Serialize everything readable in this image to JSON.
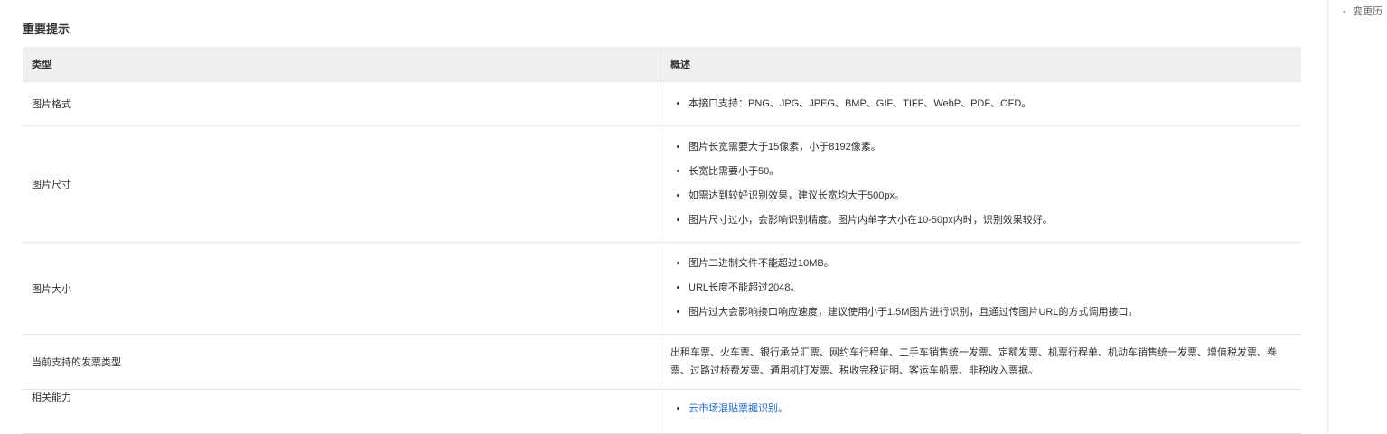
{
  "section": {
    "title": "重要提示"
  },
  "table": {
    "headers": [
      "类型",
      "概述"
    ],
    "rows": [
      {
        "type": "图片格式",
        "bullets": [
          "本接口支持：PNG、JPG、JPEG、BMP、GIF、TIFF、WebP、PDF、OFD。"
        ]
      },
      {
        "type": "图片尺寸",
        "bullets": [
          "图片长宽需要大于15像素，小于8192像素。",
          "长宽比需要小于50。",
          "如需达到较好识别效果，建议长宽均大于500px。",
          "图片尺寸过小，会影响识别精度。图片内单字大小在10-50px内时，识别效果较好。"
        ]
      },
      {
        "type": "图片大小",
        "bullets": [
          "图片二进制文件不能超过10MB。",
          "URL长度不能超过2048。",
          "图片过大会影响接口响应速度，建议使用小于1.5M图片进行识别，且通过传图片URL的方式调用接口。"
        ]
      },
      {
        "type": "当前支持的发票类型",
        "text": "出租车票、火车票、银行承兑汇票、网约车行程单、二手车销售统一发票、定额发票、机票行程单、机动车销售统一发票、增值税发票、卷票、过路过桥费发票、通用机打发票、税收完税证明、客运车船票、非税收入票据。"
      },
      {
        "type": "相关能力",
        "link": "云市场混贴票据识别。"
      }
    ]
  },
  "sidebar": {
    "item": "变更历"
  },
  "colors": {
    "link": "#1a6bd6",
    "header_bg": "#f0f0f0"
  }
}
